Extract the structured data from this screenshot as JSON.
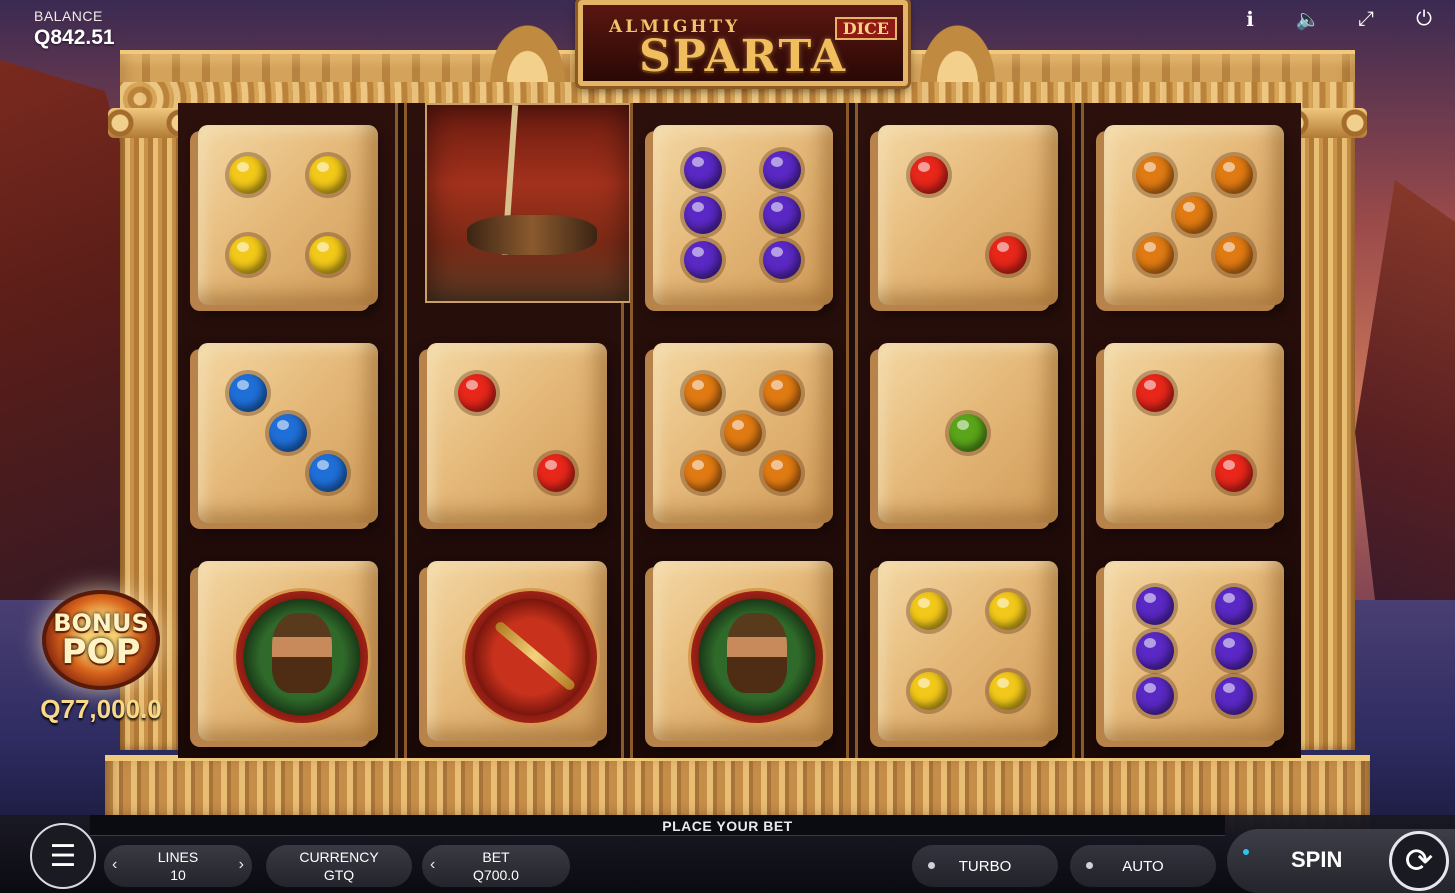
{
  "balance": {
    "label": "BALANCE",
    "value": "Q842.51"
  },
  "logo": {
    "top": "ALMIGHTY",
    "main": "SPARTA",
    "tag": "DICE"
  },
  "top_icons": [
    "info-icon",
    "sound-icon",
    "fullscreen-icon",
    "power-icon"
  ],
  "reels": [
    [
      {
        "type": "die",
        "pips": 4,
        "color": "#f2c81a"
      },
      {
        "type": "die",
        "pips": 3,
        "color": "#1f6fd8"
      },
      {
        "type": "hero",
        "symbol": "hooded-warrior"
      }
    ],
    [
      {
        "type": "warrior-card",
        "symbol": "spartan-warrior"
      },
      {
        "type": "die",
        "pips": 2,
        "color": "#e8261a"
      },
      {
        "type": "spear",
        "symbol": "spear-shield"
      }
    ],
    [
      {
        "type": "die",
        "pips": 6,
        "color": "#5a28c4"
      },
      {
        "type": "die",
        "pips": 5,
        "color": "#e07a12"
      },
      {
        "type": "hero",
        "symbol": "hooded-warrior"
      }
    ],
    [
      {
        "type": "die",
        "pips": 2,
        "color": "#e8261a"
      },
      {
        "type": "die",
        "pips": 1,
        "color": "#5aa51a"
      },
      {
        "type": "die",
        "pips": 4,
        "color": "#f2c81a"
      }
    ],
    [
      {
        "type": "die",
        "pips": 5,
        "color": "#e07a12"
      },
      {
        "type": "die",
        "pips": 2,
        "color": "#e8261a"
      },
      {
        "type": "die",
        "pips": 6,
        "color": "#5a28c4"
      }
    ]
  ],
  "bonus": {
    "line1": "BONUS",
    "line2": "POP",
    "amount": "Q77,000.0"
  },
  "bottom": {
    "message": "PLACE YOUR BET",
    "lines": {
      "label": "LINES",
      "value": "10"
    },
    "currency": {
      "label": "CURRENCY",
      "value": "GTQ"
    },
    "bet": {
      "label": "BET",
      "value": "Q700.0"
    },
    "turbo": "TURBO",
    "auto": "AUTO",
    "spin": "SPIN"
  }
}
